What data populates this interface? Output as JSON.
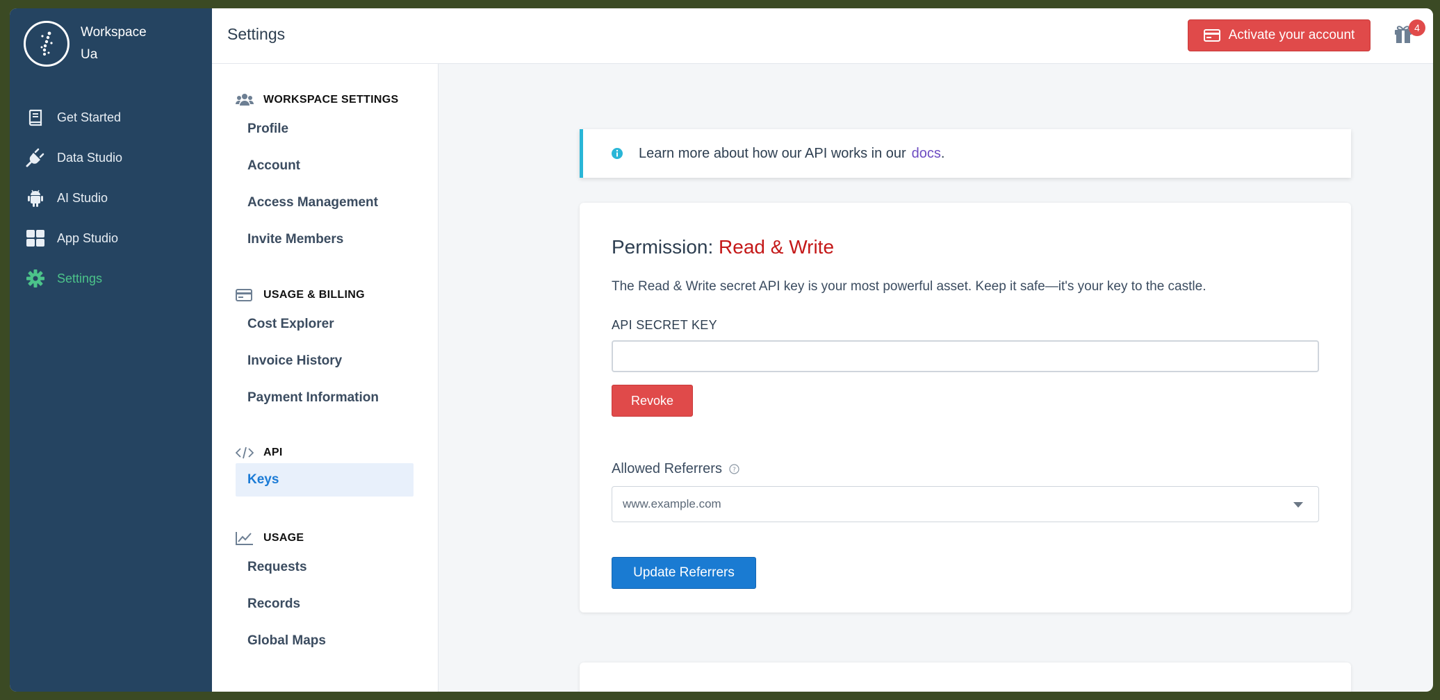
{
  "workspace": {
    "name_line1": "Workspace",
    "name_line2": "Ua"
  },
  "nav": {
    "items": [
      {
        "label": "Get Started",
        "icon": "book-icon"
      },
      {
        "label": "Data Studio",
        "icon": "plug-icon"
      },
      {
        "label": "AI Studio",
        "icon": "android-icon"
      },
      {
        "label": "App Studio",
        "icon": "grid-icon"
      },
      {
        "label": "Settings",
        "icon": "gear-icon",
        "active": true
      }
    ]
  },
  "header": {
    "title": "Settings",
    "activate_label": "Activate your account",
    "gift_badge": "4"
  },
  "subnav": {
    "workspace_settings": {
      "title": "WORKSPACE SETTINGS",
      "items": [
        "Profile",
        "Account",
        "Access Management",
        "Invite Members"
      ]
    },
    "usage_billing": {
      "title": "USAGE & BILLING",
      "items": [
        "Cost Explorer",
        "Invoice History",
        "Payment Information"
      ]
    },
    "api": {
      "title": "API",
      "items": [
        "Keys"
      ]
    },
    "usage": {
      "title": "USAGE",
      "items": [
        "Requests",
        "Records",
        "Global Maps"
      ]
    }
  },
  "info": {
    "text": "Learn more about how our API works in our",
    "link": "docs",
    "suffix": "."
  },
  "card": {
    "permission_label": "Permission:",
    "permission_value": "Read & Write",
    "description": "The Read & Write secret API key is your most powerful asset. Keep it safe—it's your key to the castle.",
    "key_label": "API SECRET KEY",
    "key_value": "",
    "revoke_label": "Revoke",
    "referrers_label": "Allowed Referrers",
    "referrers_placeholder": "www.example.com",
    "update_label": "Update Referrers"
  },
  "colors": {
    "nav_bg": "#254461",
    "accent_green": "#4cc38a",
    "danger": "#e04a4a",
    "primary": "#1a7bd2",
    "info": "#29b6d7",
    "permission": "#c41818"
  }
}
